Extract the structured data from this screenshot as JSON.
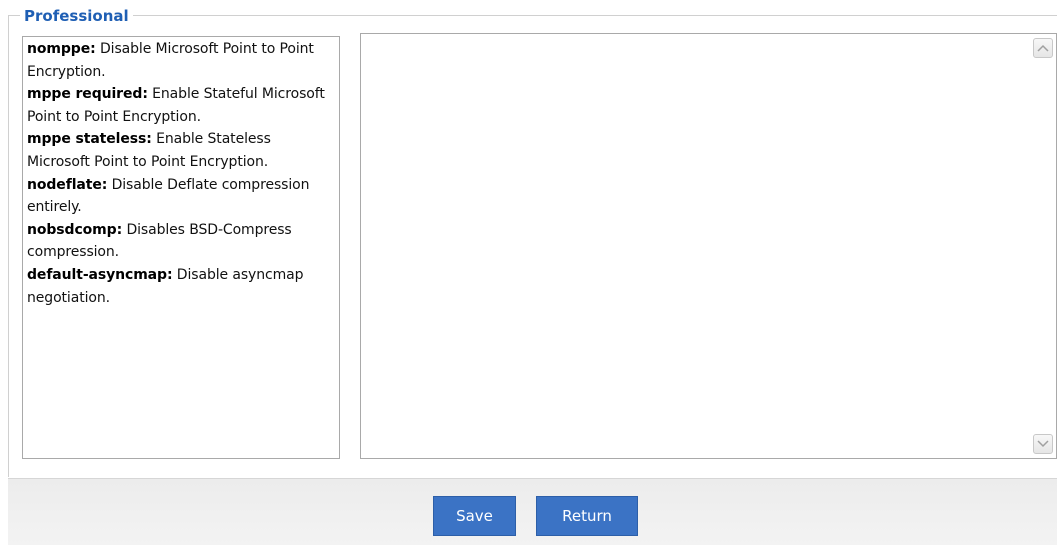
{
  "section": {
    "legend": "Professional"
  },
  "help": {
    "entries": [
      {
        "term": "nomppe",
        "desc": " Disable Microsoft Point to Point Encryption."
      },
      {
        "term": "mppe required",
        "desc": " Enable Stateful Microsoft Point to Point Encryption."
      },
      {
        "term": "mppe stateless",
        "desc": " Enable Stateless Microsoft Point to Point Encryption."
      },
      {
        "term": "nodeflate",
        "desc": " Disable Deflate compression entirely."
      },
      {
        "term": "nobsdcomp",
        "desc": " Disables BSD-Compress compression."
      },
      {
        "term": "default-asyncmap",
        "desc": " Disable asyncmap negotiation."
      }
    ]
  },
  "editor": {
    "value": ""
  },
  "footer": {
    "save_label": "Save",
    "return_label": "Return"
  },
  "colors": {
    "legend": "#1f5fb4",
    "button": "#3b73c5"
  },
  "icons": {
    "scroll_up": "chevron-up-icon",
    "scroll_down": "chevron-down-icon"
  }
}
